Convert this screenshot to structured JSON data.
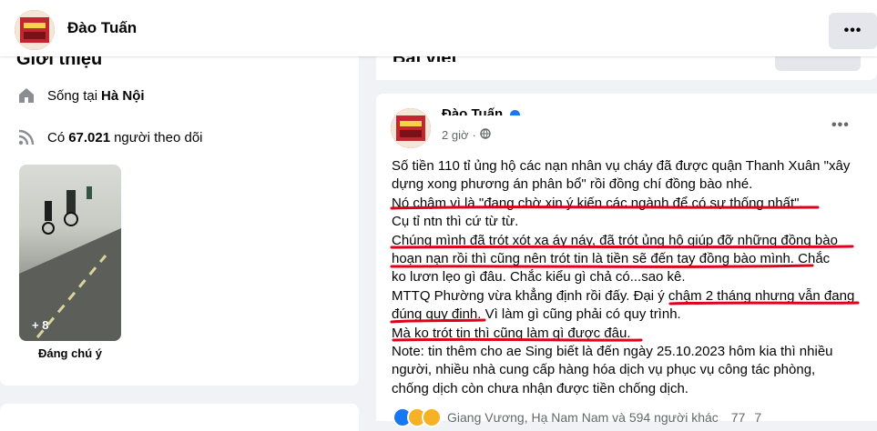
{
  "topbar": {
    "name": "Đào Tuấn",
    "more_label": "•••"
  },
  "intro": {
    "title": "Giới thiệu",
    "lives_prefix": "Sống tại",
    "lives_city": "Hà Nội",
    "followers_prefix": "Có",
    "followers_count": "67.021",
    "followers_suffix": "người theo dõi",
    "photo_count": "+ 8",
    "photo_caption": "Đáng chú ý"
  },
  "composer": {
    "title": "Bài viết"
  },
  "post": {
    "author": "Đào Tuấn",
    "time": "2 giờ",
    "dot": "·",
    "more_label": "•••",
    "lines": [
      "Số tiền 110 tỉ ủng hộ các nạn nhân vụ cháy đã được quận Thanh Xuân \"xây",
      "dựng xong phương án phân bổ\" rồi đồng chí đồng bào nhé.",
      "Nó chậm vì là \"đang chờ xin ý kiến các ngành để có sự thống nhất\".",
      "Cụ tỉ ntn thì cứ từ từ.",
      "Chúng mình đã trót xót xa áy náy, đã trót ủng hộ giúp đỡ những đồng bào",
      "hoạn nạn rồi thì cũng nên trót tin là tiền sẽ đến tay đồng bào mình. Chắc",
      "ko lươn lẹo gì đâu. Chắc kiểu gì chả có...sao kê.",
      "MTTQ Phường vừa khẳng định rồi đấy. Đại ý chậm 2 tháng nhưng vẫn đang",
      "đúng quy định. Vì làm gì cũng phải có quy trình.",
      "Mà ko trót tin thì cũng làm gì được đâu.",
      "Note: tin thêm cho ae Sing biết là đến ngày 25.10.2023 hôm kia thì nhiều",
      "người, nhiều nhà cung cấp hàng hóa dịch vụ phục vụ công tác phòng,",
      "chống dịch còn chưa nhận được tiền chống dịch."
    ],
    "reactions_text": "Giang Vương, Hạ Nam Nam và 594 người khác",
    "comments_count": "77",
    "shares_count": "7"
  },
  "colors": {
    "underline": "#e0001b",
    "verified": "#1877f2",
    "secondary_text": "#65676b"
  }
}
